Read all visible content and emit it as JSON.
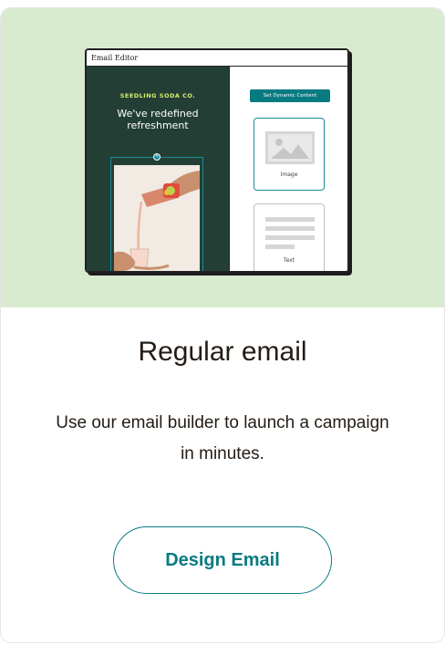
{
  "illustration": {
    "window_title": "Email Editor",
    "brand": "SEEDLING SODA CO.",
    "headline": "We've redefined refreshment",
    "dynamic_button": "Set Dynamic Content",
    "blocks": [
      {
        "label": "Image",
        "icon": "image-placeholder-icon"
      },
      {
        "label": "Text",
        "icon": "text-lines-icon"
      }
    ]
  },
  "card": {
    "title": "Regular email",
    "description": "Use our email builder to launch a campaign in minutes.",
    "cta_label": "Design Email"
  },
  "colors": {
    "hero_bg": "#d9ebcf",
    "editor_dark": "#233f35",
    "accent": "#087a82",
    "text": "#241c15"
  }
}
